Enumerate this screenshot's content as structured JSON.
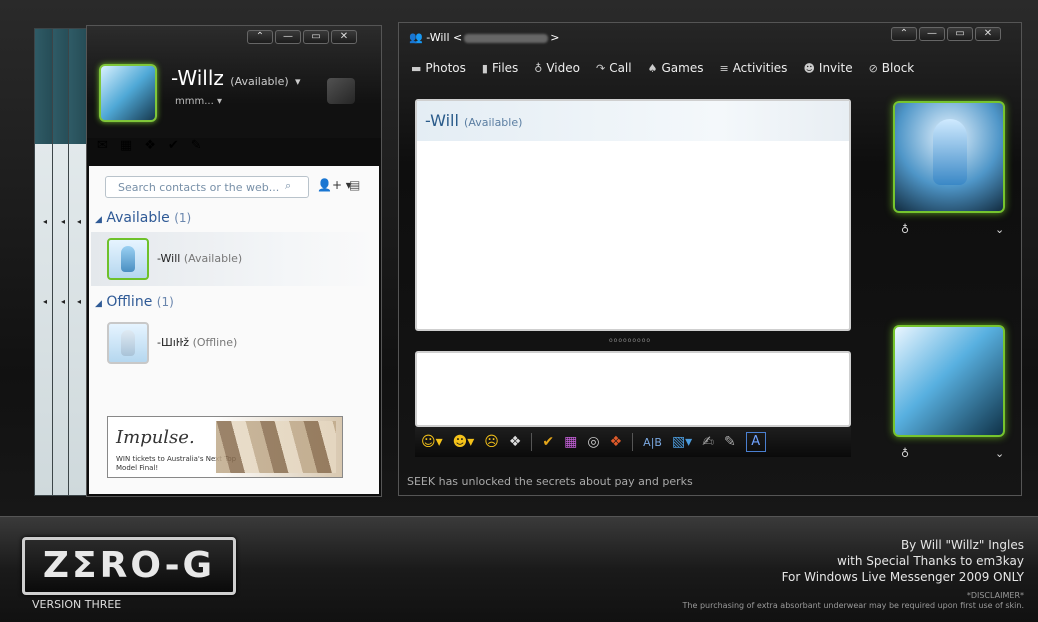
{
  "contact_list": {
    "window_controls": [
      "⌃",
      "—",
      "▭",
      "✕"
    ],
    "self": {
      "name": "-Willz",
      "status": "(Available)",
      "psm": "mmm..."
    },
    "search": {
      "placeholder": "Search contacts or the web..."
    },
    "groups": [
      {
        "label": "Available",
        "count": "(1)"
      },
      {
        "label": "Offline",
        "count": "(1)"
      }
    ],
    "contacts": [
      {
        "name": "-Will",
        "status": "(Available)"
      },
      {
        "name": "-Шıŀŀž",
        "status": "(Offline)"
      }
    ],
    "ad": {
      "brand": "Impulse.",
      "tagline": "WIN tickets to Australia's Next Top Model Final!"
    }
  },
  "conversation": {
    "title_prefix": "-Will <",
    "title_suffix": ">",
    "window_controls": [
      "⌃",
      "—",
      "▭",
      "✕"
    ],
    "menu": [
      {
        "label": "Photos",
        "icon": "photos-icon"
      },
      {
        "label": "Files",
        "icon": "files-icon"
      },
      {
        "label": "Video",
        "icon": "webcam-icon"
      },
      {
        "label": "Call",
        "icon": "phone-icon"
      },
      {
        "label": "Games",
        "icon": "games-icon"
      },
      {
        "label": "Activities",
        "icon": "activities-icon"
      },
      {
        "label": "Invite",
        "icon": "invite-icon"
      },
      {
        "label": "Block",
        "icon": "block-icon"
      }
    ],
    "history": {
      "contact_name": "-Will",
      "contact_status": "(Available)"
    },
    "status_message": "SEEK has unlocked the secrets about pay and perks"
  },
  "banner": {
    "logo": "ZΣRO-G",
    "version": "VERSION THREE",
    "credits": [
      "By Will \"Willz\" Ingles",
      "with Special Thanks to em3kay",
      "For Windows Live Messenger 2009 ONLY"
    ],
    "disclaimer_title": "*DISCLAIMER*",
    "disclaimer_text": "The purchasing of extra absorbant underwear may be required upon first use of skin."
  },
  "colors": {
    "accent_green": "#7fc63a",
    "link_blue": "#2f5a96",
    "background": "#111111"
  }
}
